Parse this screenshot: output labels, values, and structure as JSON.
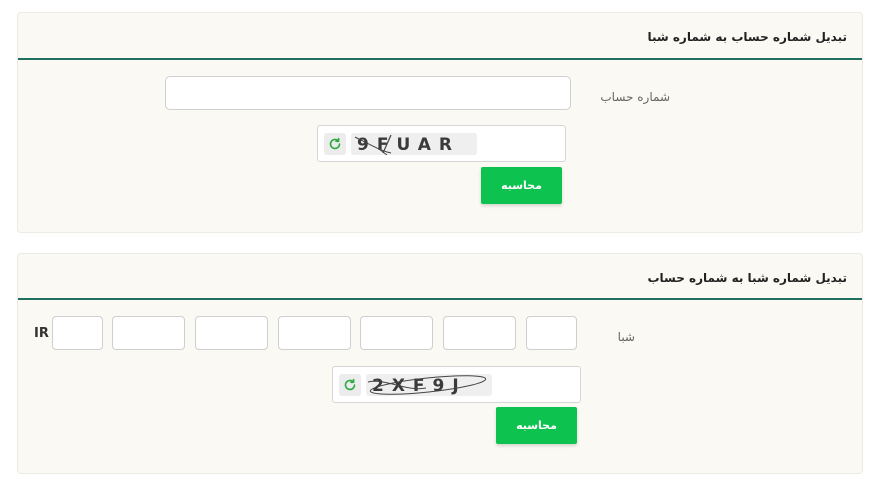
{
  "account_to_sheba": {
    "title": "تبدیل شماره حساب به شماره شبا",
    "account_label": "شماره حساب",
    "account_value": "",
    "captcha_text": "9FUAR",
    "button_label": "محاسبه"
  },
  "sheba_to_account": {
    "title": "تبدیل شماره شبا به شماره حساب",
    "sheba_label": "شبا",
    "prefix": "IR",
    "captcha_text": "2XF9J",
    "button_label": "محاسبه"
  },
  "colors": {
    "accent_green": "#0ec250",
    "header_line": "#1f6f63",
    "panel_bg": "#fbf9f3",
    "refresh_icon": "#2eaa44"
  }
}
